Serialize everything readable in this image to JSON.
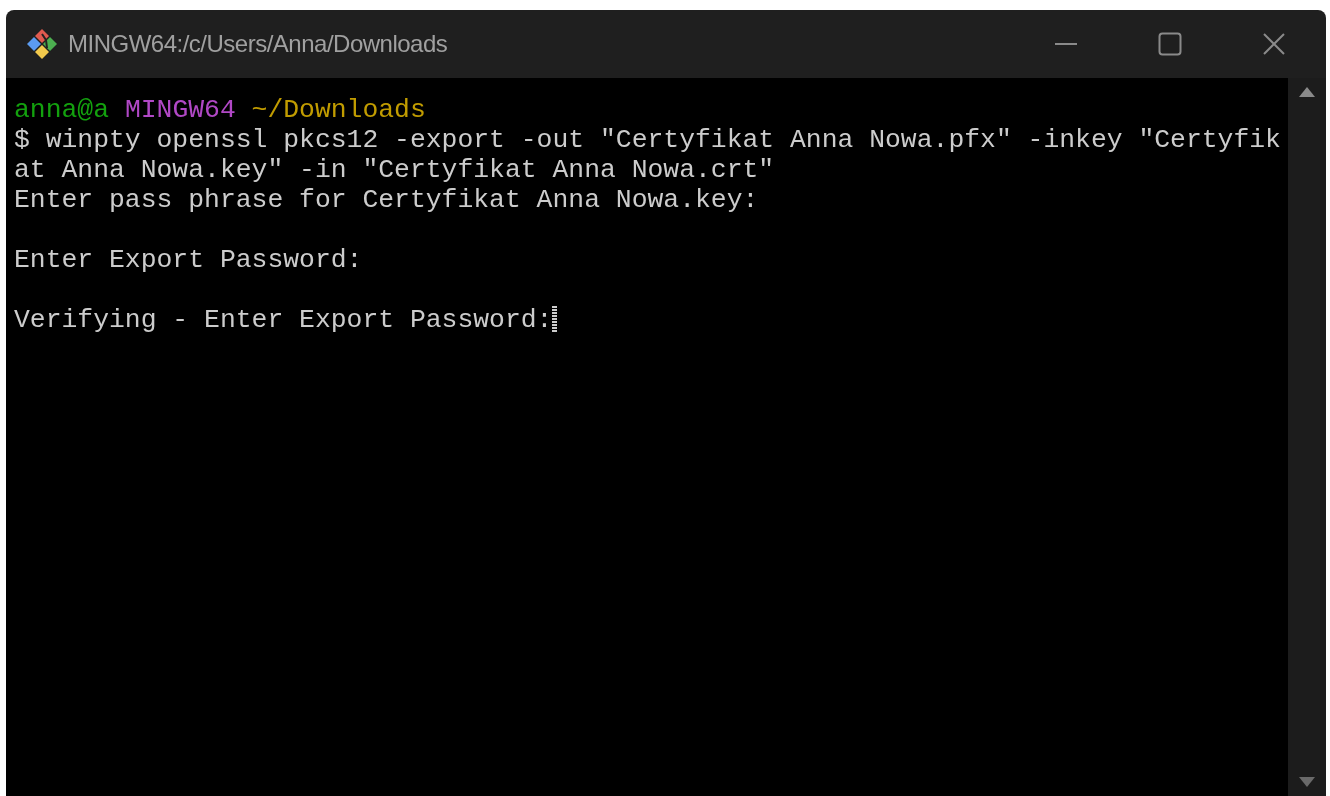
{
  "window": {
    "title": "MINGW64:/c/Users/Anna/Downloads"
  },
  "terminal": {
    "lines": [
      {
        "kind": "prompt",
        "segments": [
          {
            "text": "anna@a",
            "color": "#13a10e"
          },
          {
            "text": "MINGW64",
            "color": "#b148c6"
          },
          {
            "text": "~/Downloads",
            "color": "#c19c00"
          }
        ]
      },
      {
        "kind": "text",
        "text": "$ winpty openssl pkcs12 -export -out \"Certyfikat Anna Nowa.pfx\" -inkey \"Certyfik"
      },
      {
        "kind": "text",
        "text": "at Anna Nowa.key\" -in \"Certyfikat Anna Nowa.crt\""
      },
      {
        "kind": "text",
        "text": "Enter pass phrase for Certyfikat Anna Nowa.key:"
      },
      {
        "kind": "blank"
      },
      {
        "kind": "text",
        "text": "Enter Export Password:"
      },
      {
        "kind": "blank"
      },
      {
        "kind": "text",
        "text": "Verifying - Enter Export Password:",
        "cursor": true
      }
    ]
  }
}
